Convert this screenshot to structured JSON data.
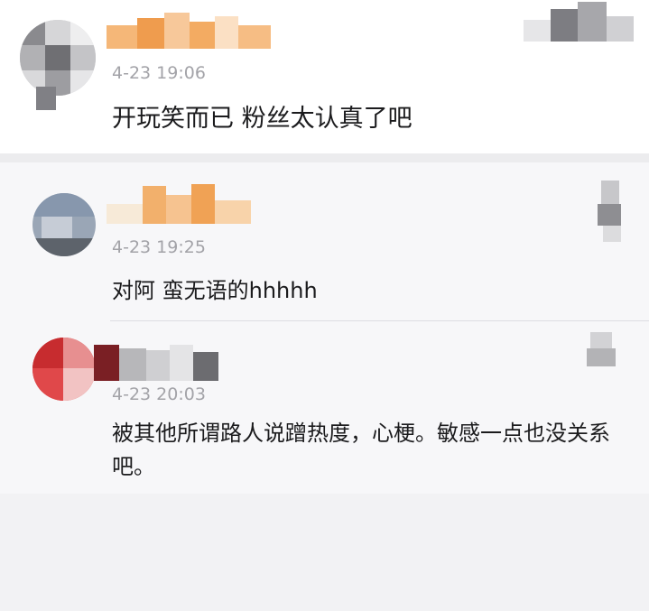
{
  "main_comment": {
    "time": "4-23 19:06",
    "text": "开玩笑而已 粉丝太认真了吧"
  },
  "replies": [
    {
      "time": "4-23 19:25",
      "text": "对阿 蛮无语的hhhhh"
    },
    {
      "time": "4-23 20:03",
      "text": "被其他所谓路人说蹭热度，心梗。敏感一点也没关系吧。"
    }
  ],
  "colors": {
    "name_orange": "#f2a34a",
    "timestamp_gray": "#a3a3a8",
    "text_dark": "#1b1b1d"
  }
}
